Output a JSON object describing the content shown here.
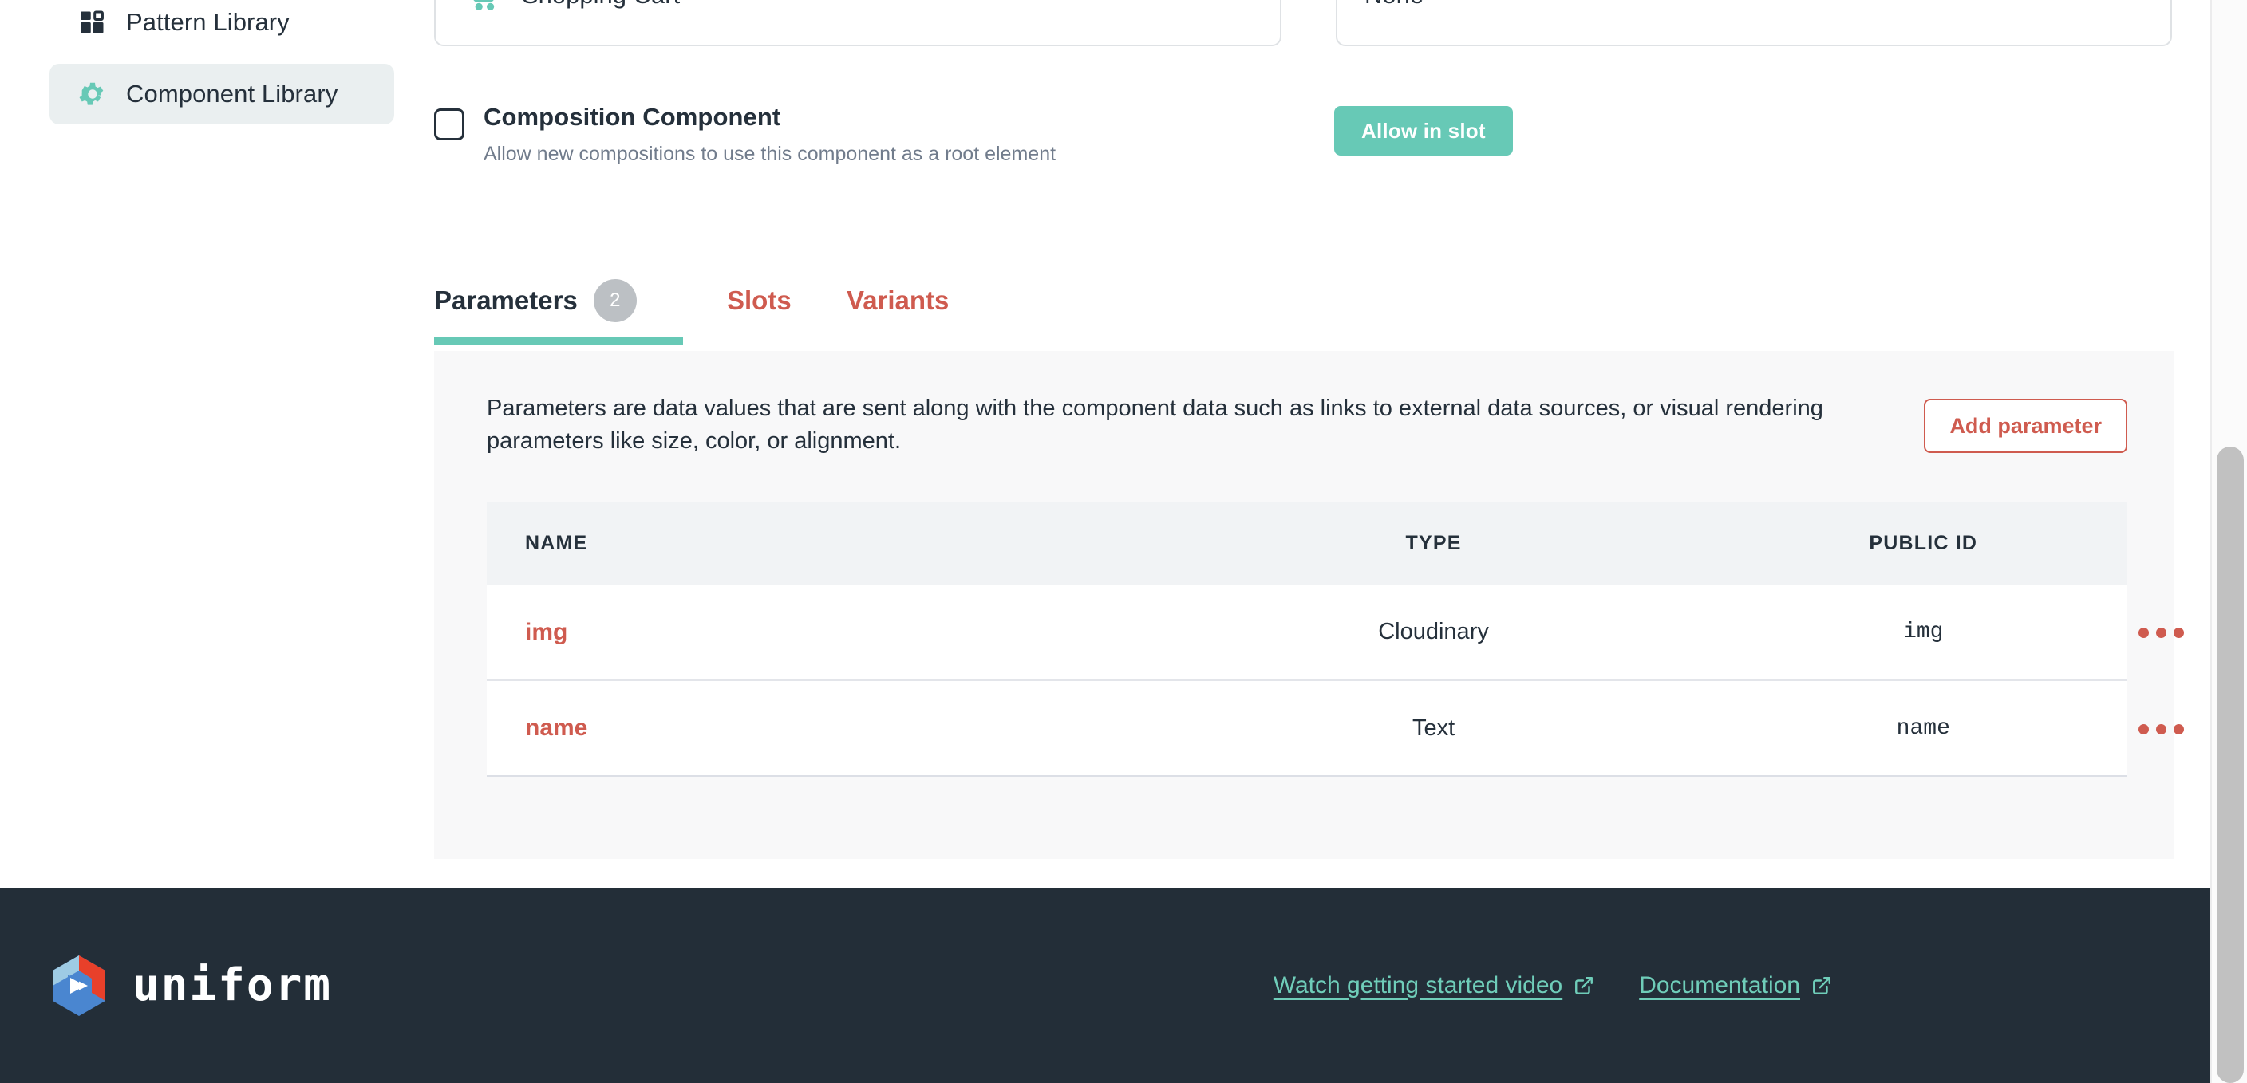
{
  "sidebar": {
    "items": [
      {
        "label": "Pattern Library",
        "icon": "pattern-library-icon",
        "active": false
      },
      {
        "label": "Component Library",
        "icon": "gear-icon",
        "active": true
      }
    ]
  },
  "component_form": {
    "component_card": {
      "name": "Shopping Cart",
      "icon": "shopping-cart-icon"
    },
    "icon_select": {
      "value": "None",
      "caret_icon": "chevron-down-icon"
    },
    "composition_component": {
      "label": "Composition Component",
      "description": "Allow new compositions to use this component as a root element",
      "checked": false
    },
    "allow_in_slot_label": "Allow in slot"
  },
  "tabs": [
    {
      "label": "Parameters",
      "badge": "2",
      "active": true
    },
    {
      "label": "Slots",
      "badge": null,
      "active": false
    },
    {
      "label": "Variants",
      "badge": null,
      "active": false
    }
  ],
  "parameters_panel": {
    "description": "Parameters are data values that are sent along with the component data such as links to external data sources, or visual rendering parameters like size, color, or alignment.",
    "add_button_label": "Add parameter",
    "table": {
      "columns": [
        "NAME",
        "TYPE",
        "PUBLIC ID"
      ],
      "rows": [
        {
          "name": "img",
          "type": "Cloudinary",
          "public_id": "img",
          "actions_icon": "more-options-icon"
        },
        {
          "name": "name",
          "type": "Text",
          "public_id": "name",
          "actions_icon": "more-options-icon"
        }
      ]
    }
  },
  "footer": {
    "brand": "uniform",
    "links": [
      {
        "label": "Watch getting started video",
        "icon": "external-link-icon"
      },
      {
        "label": "Documentation",
        "icon": "external-link-icon"
      }
    ]
  },
  "colors": {
    "accent_green": "#67c9b6",
    "accent_red": "#cf5b4f",
    "text_dark": "#25303b",
    "text_muted": "#717c8c",
    "footer_bg": "#232e38",
    "panel_bg": "#f8f8f9",
    "sidebar_active_bg": "#eaeff0"
  }
}
